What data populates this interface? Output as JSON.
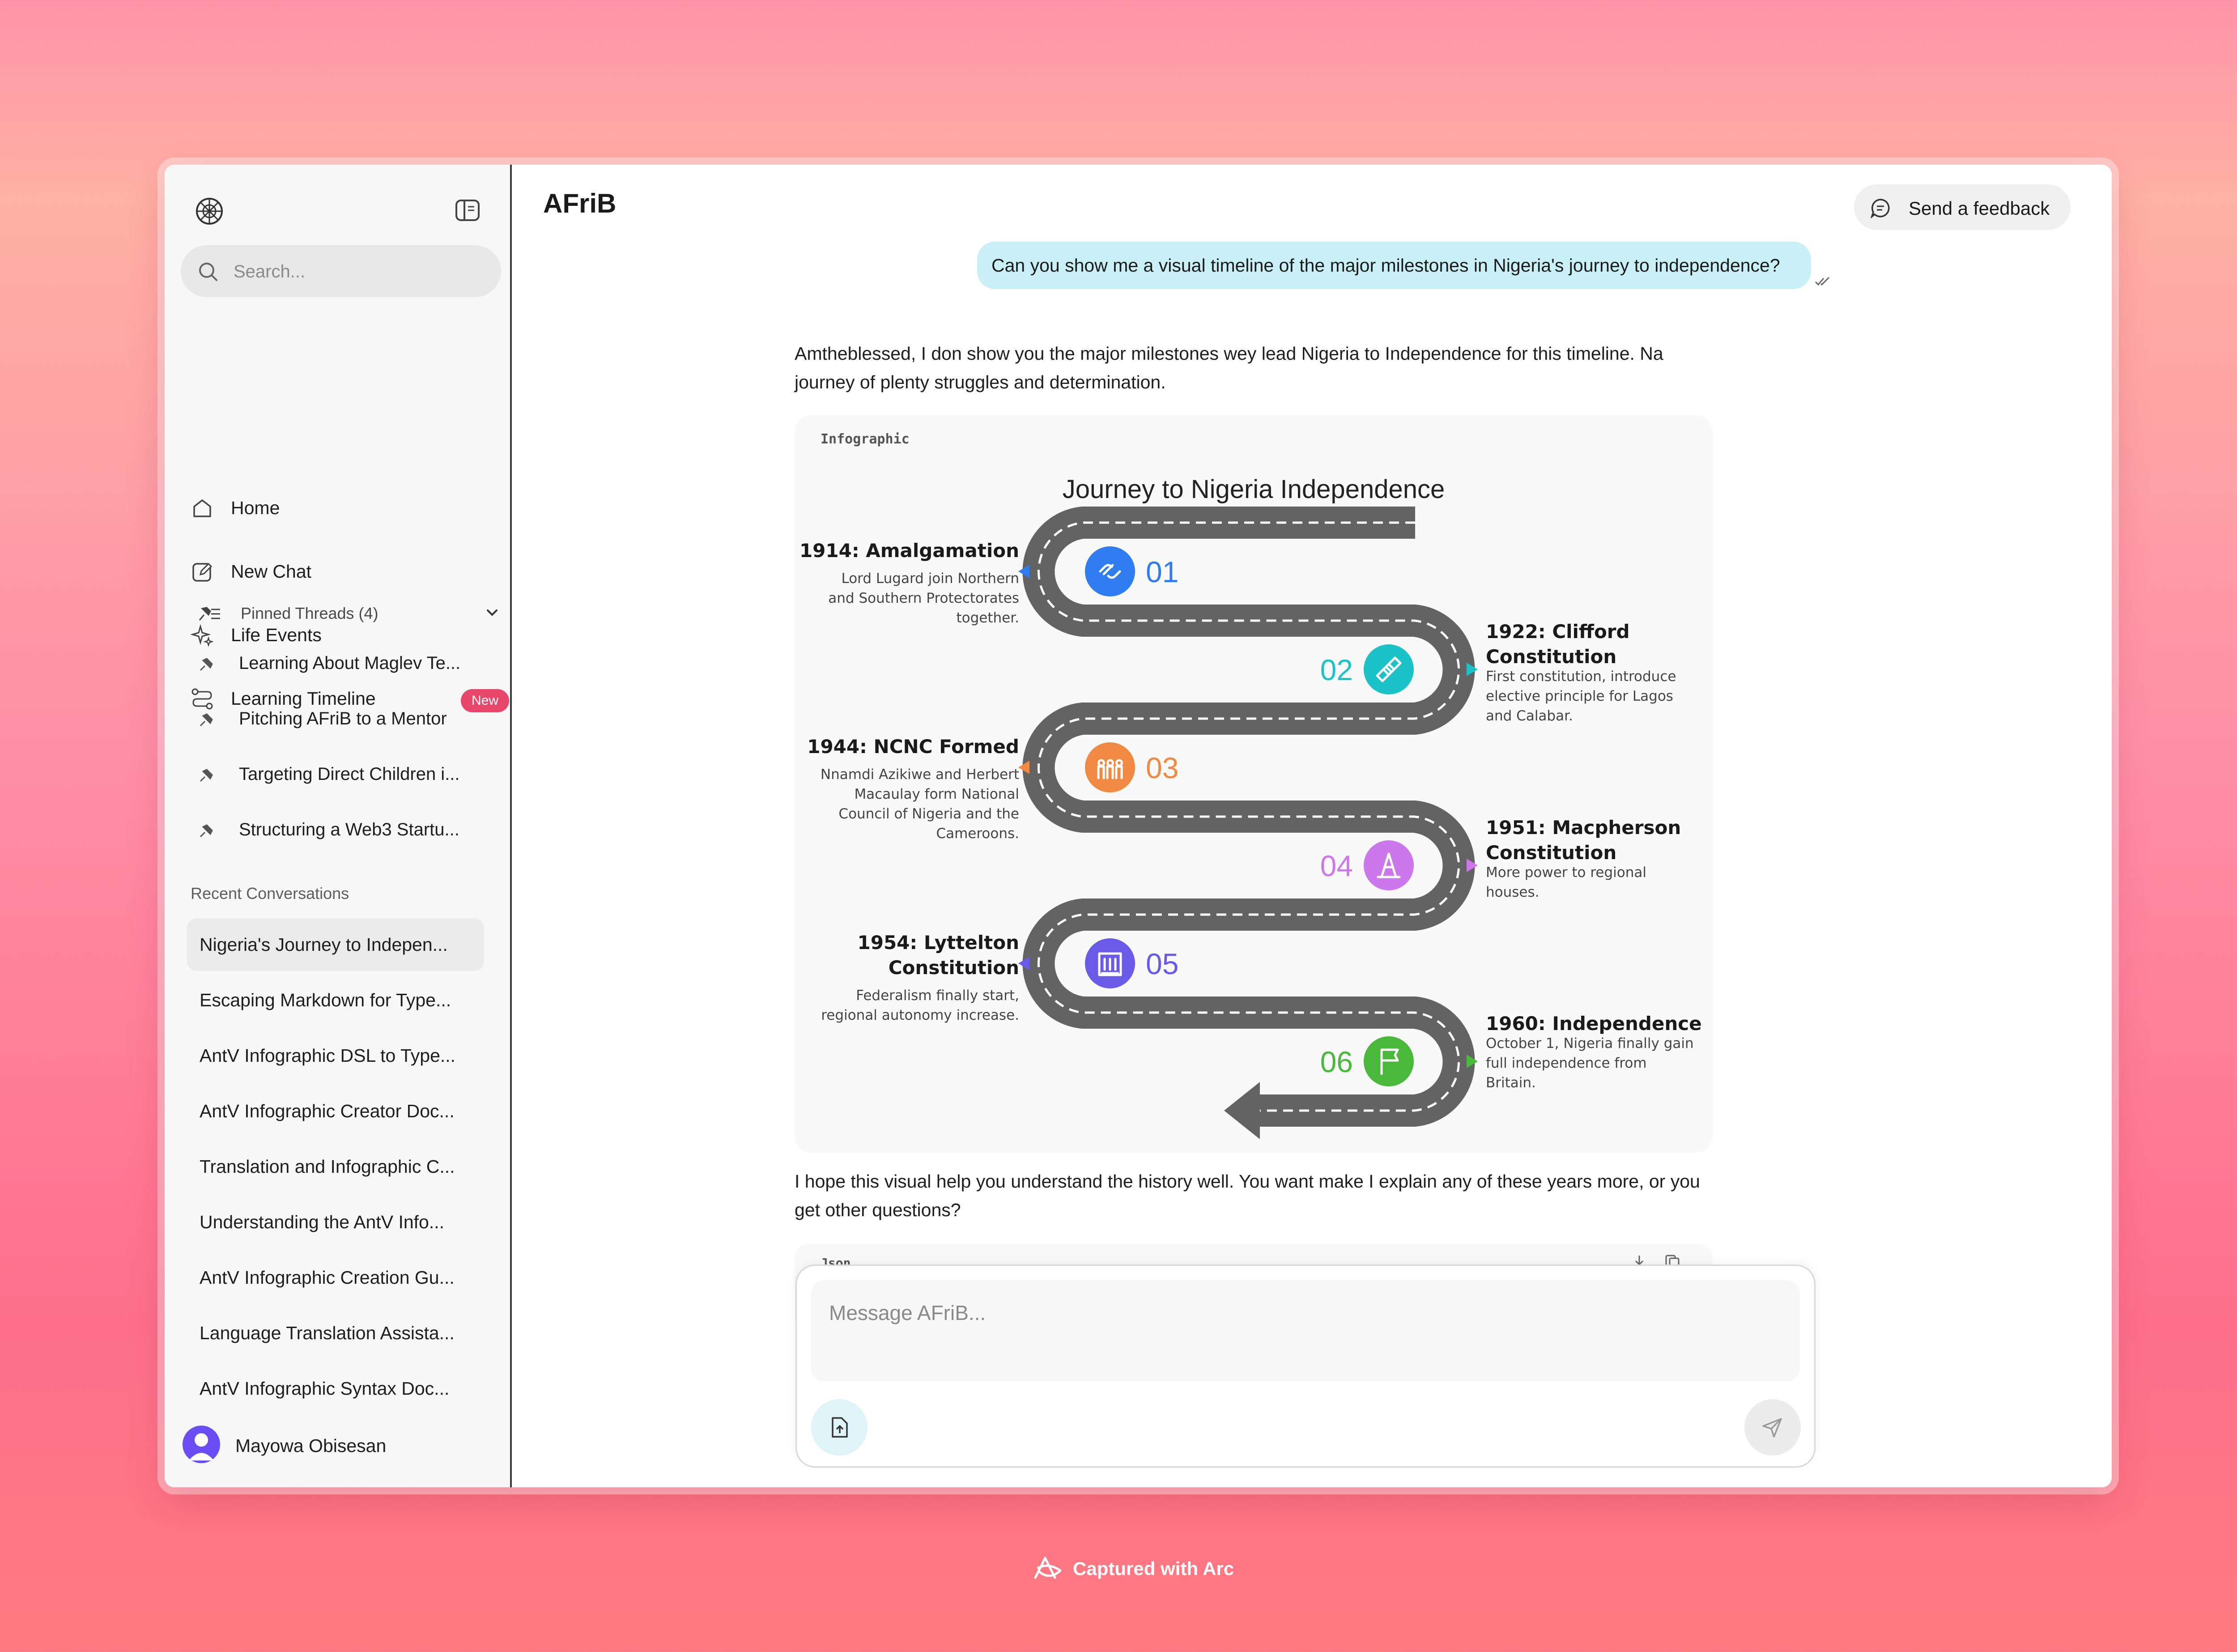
{
  "app": {
    "title": "AFriB"
  },
  "sidebar": {
    "search_placeholder": "Search...",
    "nav": [
      {
        "label": "Home"
      },
      {
        "label": "New Chat"
      },
      {
        "label": "Life Events"
      },
      {
        "label": "Learning Timeline",
        "badge": "New"
      }
    ],
    "pinned": {
      "header": "Pinned Threads (4)",
      "items": [
        "Learning About Maglev Te...",
        "Pitching AFriB to a Mentor",
        "Targeting Direct Children i...",
        "Structuring a Web3 Startu..."
      ]
    },
    "recent": {
      "title": "Recent Conversations",
      "items": [
        "Nigeria's Journey to Indepen...",
        "Escaping Markdown for Type...",
        "AntV Infographic DSL to Type...",
        "AntV Infographic Creator Doc...",
        "Translation and Infographic C...",
        "Understanding the AntV Info...",
        "AntV Infographic Creation Gu...",
        "Language Translation Assista...",
        "AntV Infographic Syntax Doc..."
      ]
    },
    "user": {
      "name": "Mayowa Obisesan"
    }
  },
  "header": {
    "feedback_label": "Send a feedback"
  },
  "chat": {
    "user_message": "Can you show me a visual timeline of the major milestones in Nigeria's journey to independence?",
    "ai_intro": "Amtheblessed, I don show you the major milestones wey lead Nigeria to Independence for this timeline. Na journey of plenty struggles and determination.",
    "infographic": {
      "tag": "Infographic",
      "title": "Journey to Nigeria Independence",
      "steps": [
        {
          "num": "01",
          "title": "1914: Amalgamation",
          "desc": [
            "Lord Lugard join Northern",
            "and Southern Protectorates",
            "together."
          ],
          "color": "#2f7df0",
          "icon": "link-icon"
        },
        {
          "num": "02",
          "title": "1922: Clifford",
          "title2": "Constitution",
          "desc": [
            "First constitution, introduce",
            "elective principle for Lagos",
            "and Calabar."
          ],
          "color": "#1bc3c9",
          "icon": "bandage-icon"
        },
        {
          "num": "03",
          "title": "1944: NCNC Formed",
          "desc": [
            "Nnamdi Azikiwe and Herbert",
            "Macaulay form National",
            "Council of Nigeria and the",
            "Cameroons."
          ],
          "color": "#f08a43",
          "icon": "people-icon"
        },
        {
          "num": "04",
          "title": "1951: Macpherson",
          "title2": "Constitution",
          "desc": [
            "More power to regional",
            "houses."
          ],
          "color": "#cc78ec",
          "icon": "cone-icon"
        },
        {
          "num": "05",
          "title": "1954: Lyttelton",
          "title2": "Constitution",
          "desc": [
            "Federalism finally start,",
            "regional autonomy increase."
          ],
          "color": "#6a5ae8",
          "icon": "building-icon"
        },
        {
          "num": "06",
          "title": "1960: Independence",
          "desc": [
            "October 1, Nigeria finally gain",
            "full independence from",
            "Britain."
          ],
          "color": "#4ab83a",
          "icon": "flag-icon"
        }
      ]
    },
    "ai_outro": "I hope this visual help you understand the history well. You want make I explain any of these years more, or you get other questions?",
    "json_tag": "Json"
  },
  "composer": {
    "placeholder": "Message AFriB..."
  },
  "footer": {
    "label": "Captured with Arc"
  }
}
